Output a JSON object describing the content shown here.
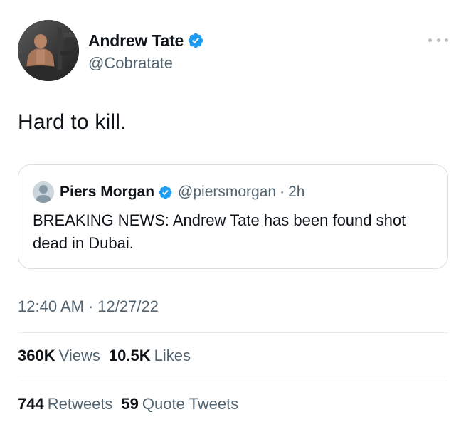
{
  "author": {
    "name": "Andrew Tate",
    "handle": "@Cobratate",
    "verified": true
  },
  "tweet": {
    "text": "Hard to kill."
  },
  "quoted_tweet": {
    "name": "Piers Morgan",
    "handle": "@piersmorgan",
    "separator": "·",
    "time": "2h",
    "text": "BREAKING NEWS: Andrew Tate has been found shot dead in Dubai.",
    "verified": true
  },
  "meta": {
    "time": "12:40 AM",
    "separator": "·",
    "date": "12/27/22"
  },
  "stats": {
    "views_count": "360K",
    "views_label": "Views",
    "likes_count": "10.5K",
    "likes_label": "Likes",
    "retweets_count": "744",
    "retweets_label": "Retweets",
    "quotes_count": "59",
    "quotes_label": "Quote Tweets"
  },
  "colors": {
    "verified_blue": "#1d9bf0",
    "secondary_text": "#536471",
    "primary_text": "#0f1419",
    "divider": "#e6ecf0"
  },
  "icons": {
    "verified": "verified-badge-icon",
    "more": "more-options-icon",
    "default_avatar": "default-avatar-icon"
  }
}
